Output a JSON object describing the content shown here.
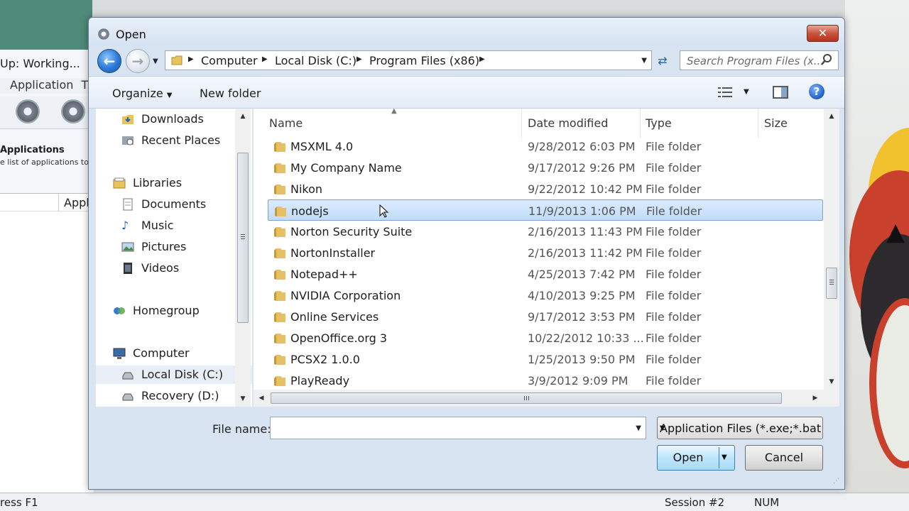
{
  "background_app": {
    "status_text": "Up: Working...",
    "menu": [
      "Application",
      "T"
    ],
    "section_title": "Applications",
    "section_subtitle": "e list of applications to",
    "column_header": "Appl",
    "statusbar_left": "ress F1",
    "statusbar_session": "Session #2",
    "statusbar_num": "NUM"
  },
  "dialog": {
    "title": "Open",
    "close_label": "✕",
    "address": {
      "crumbs": [
        "Computer",
        "Local Disk (C:)",
        "Program Files (x86)"
      ]
    },
    "search_placeholder": "Search Program Files (x...",
    "toolbar": {
      "organize": "Organize",
      "new_folder": "New folder"
    },
    "nav": {
      "items": [
        {
          "label": "Downloads",
          "icon": "downloads-icon"
        },
        {
          "label": "Recent Places",
          "icon": "recent-places-icon"
        },
        {
          "label": "Libraries",
          "icon": "libraries-icon"
        },
        {
          "label": "Documents",
          "icon": "documents-icon"
        },
        {
          "label": "Music",
          "icon": "music-icon"
        },
        {
          "label": "Pictures",
          "icon": "pictures-icon"
        },
        {
          "label": "Videos",
          "icon": "videos-icon"
        },
        {
          "label": "Homegroup",
          "icon": "homegroup-icon"
        },
        {
          "label": "Computer",
          "icon": "computer-icon"
        },
        {
          "label": "Local Disk (C:)",
          "icon": "drive-icon",
          "selected": true
        },
        {
          "label": "Recovery (D:)",
          "icon": "drive-icon"
        }
      ]
    },
    "columns": [
      "Name",
      "Date modified",
      "Type",
      "Size"
    ],
    "files": [
      {
        "name": "MSXML 4.0",
        "date": "9/28/2012 6:03 PM",
        "type": "File folder"
      },
      {
        "name": "My Company Name",
        "date": "9/17/2012 9:26 PM",
        "type": "File folder"
      },
      {
        "name": "Nikon",
        "date": "9/22/2012 10:42 PM",
        "type": "File folder"
      },
      {
        "name": "nodejs",
        "date": "11/9/2013 1:06 PM",
        "type": "File folder",
        "selected": true
      },
      {
        "name": "Norton Security Suite",
        "date": "2/16/2013 11:43 PM",
        "type": "File folder"
      },
      {
        "name": "NortonInstaller",
        "date": "2/16/2013 11:42 PM",
        "type": "File folder"
      },
      {
        "name": "Notepad++",
        "date": "4/25/2013 7:42 PM",
        "type": "File folder"
      },
      {
        "name": "NVIDIA Corporation",
        "date": "4/10/2013 9:25 PM",
        "type": "File folder"
      },
      {
        "name": "Online Services",
        "date": "9/17/2012 3:53 PM",
        "type": "File folder"
      },
      {
        "name": "OpenOffice.org 3",
        "date": "10/22/2012 10:33 ...",
        "type": "File folder"
      },
      {
        "name": "PCSX2 1.0.0",
        "date": "1/25/2013 9:50 PM",
        "type": "File folder"
      },
      {
        "name": "PlayReady",
        "date": "3/9/2012 9:09 PM",
        "type": "File folder"
      }
    ],
    "file_name_label": "File name:",
    "file_name_value": "",
    "filter_label": "Application Files (*.exe;*.bat",
    "open_label": "Open",
    "cancel_label": "Cancel"
  },
  "colors": {
    "selection": "#cce4fc",
    "selection_border": "#7da2ce",
    "close_red": "#c9553f",
    "nav_blue": "#2a78d6"
  }
}
